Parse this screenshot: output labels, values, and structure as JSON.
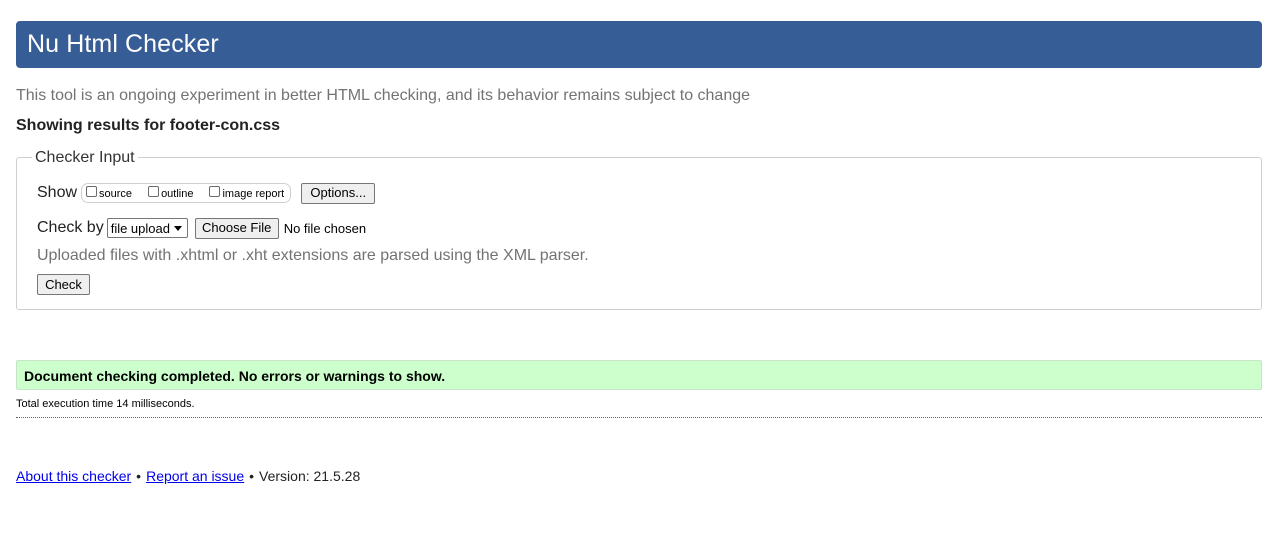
{
  "header": {
    "title": "Nu Html Checker"
  },
  "subtitle": "This tool is an ongoing experiment in better HTML checking, and its behavior remains subject to change",
  "results_heading": "Showing results for footer-con.css",
  "checker_input": {
    "legend": "Checker Input",
    "show_label": "Show",
    "show_options": [
      {
        "label": "source",
        "checked": false
      },
      {
        "label": "outline",
        "checked": false
      },
      {
        "label": "image report",
        "checked": false
      }
    ],
    "options_button": "Options...",
    "check_by_label": "Check by",
    "check_by_selected": "file upload",
    "choose_file_button": "Choose File",
    "no_file_text": "No file chosen",
    "parser_note": "Uploaded files with .xhtml or .xht extensions are parsed using the XML parser.",
    "check_button": "Check"
  },
  "result": {
    "message": "Document checking completed. No errors or warnings to show.",
    "background_color": "#ccffcc",
    "execution_time": "Total execution time 14 milliseconds."
  },
  "footer": {
    "about_link": "About this checker",
    "separator": "•",
    "report_link": "Report an issue",
    "version_text": "Version: 21.5.28"
  },
  "colors": {
    "header_bg": "#365d95",
    "link": "#0000ee",
    "muted_text": "#737373"
  }
}
